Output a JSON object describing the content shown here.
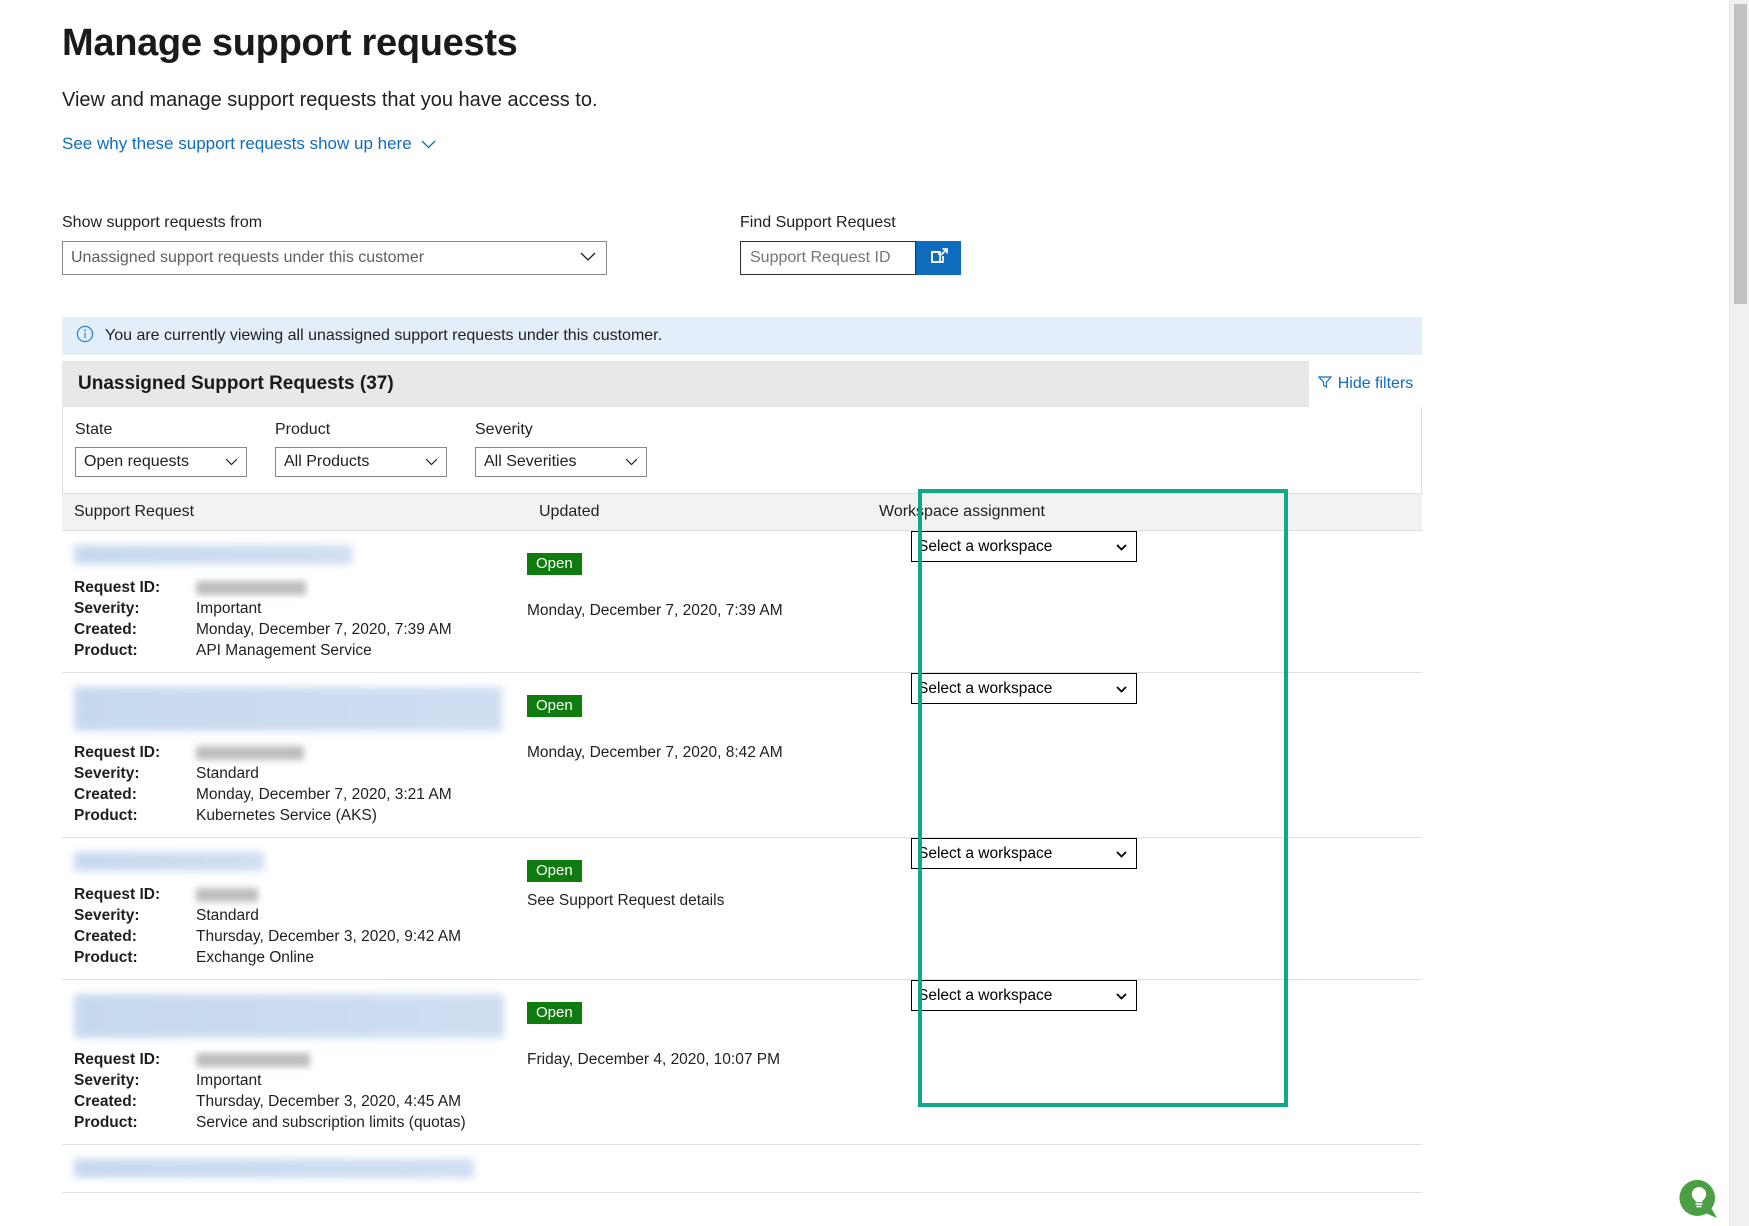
{
  "header": {
    "title": "Manage support requests",
    "subtitle": "View and manage support requests that you have access to.",
    "why_link": "See why these support requests show up here",
    "chevron_icon": "chevron-down-icon"
  },
  "controls": {
    "show_from_label": "Show support requests from",
    "show_from_value": "Unassigned support requests under this customer",
    "find_label": "Find Support Request",
    "find_placeholder": "Support Request ID",
    "find_value": "",
    "find_button_icon": "open-in-new-window-icon"
  },
  "info_banner": {
    "icon": "info-circle-icon",
    "text": "You are currently viewing all unassigned support requests under this customer."
  },
  "panel": {
    "title": "Unassigned Support Requests (37)",
    "hide_filters_label": "Hide filters",
    "filter_icon": "funnel-icon",
    "filters": [
      {
        "label": "State",
        "value": "Open requests"
      },
      {
        "label": "Product",
        "value": "All Products"
      },
      {
        "label": "Severity",
        "value": "All Severities"
      }
    ]
  },
  "table": {
    "columns": {
      "request": "Support Request",
      "updated": "Updated",
      "workspace": "Workspace assignment"
    },
    "field_labels": {
      "request_id": "Request ID:",
      "severity": "Severity:",
      "created": "Created:",
      "product": "Product:"
    },
    "workspace_placeholder": "Select a workspace",
    "rows": [
      {
        "title_redacted": true,
        "title_width": 278,
        "title_lines": 1,
        "request_id_redacted": true,
        "request_id_width": 110,
        "severity": "Important",
        "created": "Monday, December 7, 2020, 7:39 AM",
        "product": "API Management Service",
        "status": "Open",
        "updated": "Monday, December 7, 2020, 7:39 AM",
        "updated_link": "",
        "workspace": "Select a workspace"
      },
      {
        "title_redacted": true,
        "title_width": 428,
        "title_lines": 2,
        "request_id_redacted": true,
        "request_id_width": 108,
        "severity": "Standard",
        "created": "Monday, December 7, 2020, 3:21 AM",
        "product": "Kubernetes Service (AKS)",
        "status": "Open",
        "updated": "Monday, December 7, 2020, 8:42 AM",
        "updated_link": "",
        "workspace": "Select a workspace"
      },
      {
        "title_redacted": true,
        "title_width": 190,
        "title_lines": 1,
        "request_id_redacted": true,
        "request_id_width": 62,
        "severity": "Standard",
        "created": "Thursday, December 3, 2020, 9:42 AM",
        "product": "Exchange Online",
        "status": "Open",
        "updated": "",
        "updated_link": "See Support Request details",
        "workspace": "Select a workspace"
      },
      {
        "title_redacted": true,
        "title_width": 452,
        "title_lines": 2,
        "request_id_redacted": true,
        "request_id_width": 114,
        "severity": "Important",
        "created": "Thursday, December 3, 2020, 4:45 AM",
        "product": "Service and subscription limits (quotas)",
        "status": "Open",
        "updated": "Friday, December 4, 2020, 10:07 PM",
        "updated_link": "",
        "workspace": "Select a workspace"
      },
      {
        "title_redacted": true,
        "title_width": 400,
        "title_lines": 1,
        "partial": true,
        "request_id_redacted": true,
        "request_id_width": 110,
        "severity": "",
        "created": "",
        "product": "",
        "status": "",
        "updated": "",
        "updated_link": "",
        "workspace": ""
      }
    ]
  },
  "highlight": {
    "color": "#11a88a",
    "name": "workspace-assignment-highlight"
  },
  "feedback_widget": {
    "icon": "lightbulb-chat-icon",
    "color": "#4a9e44"
  },
  "scrollbar": {
    "thumb_color": "#c1c1c1",
    "track_color": "#f1f1f1"
  }
}
